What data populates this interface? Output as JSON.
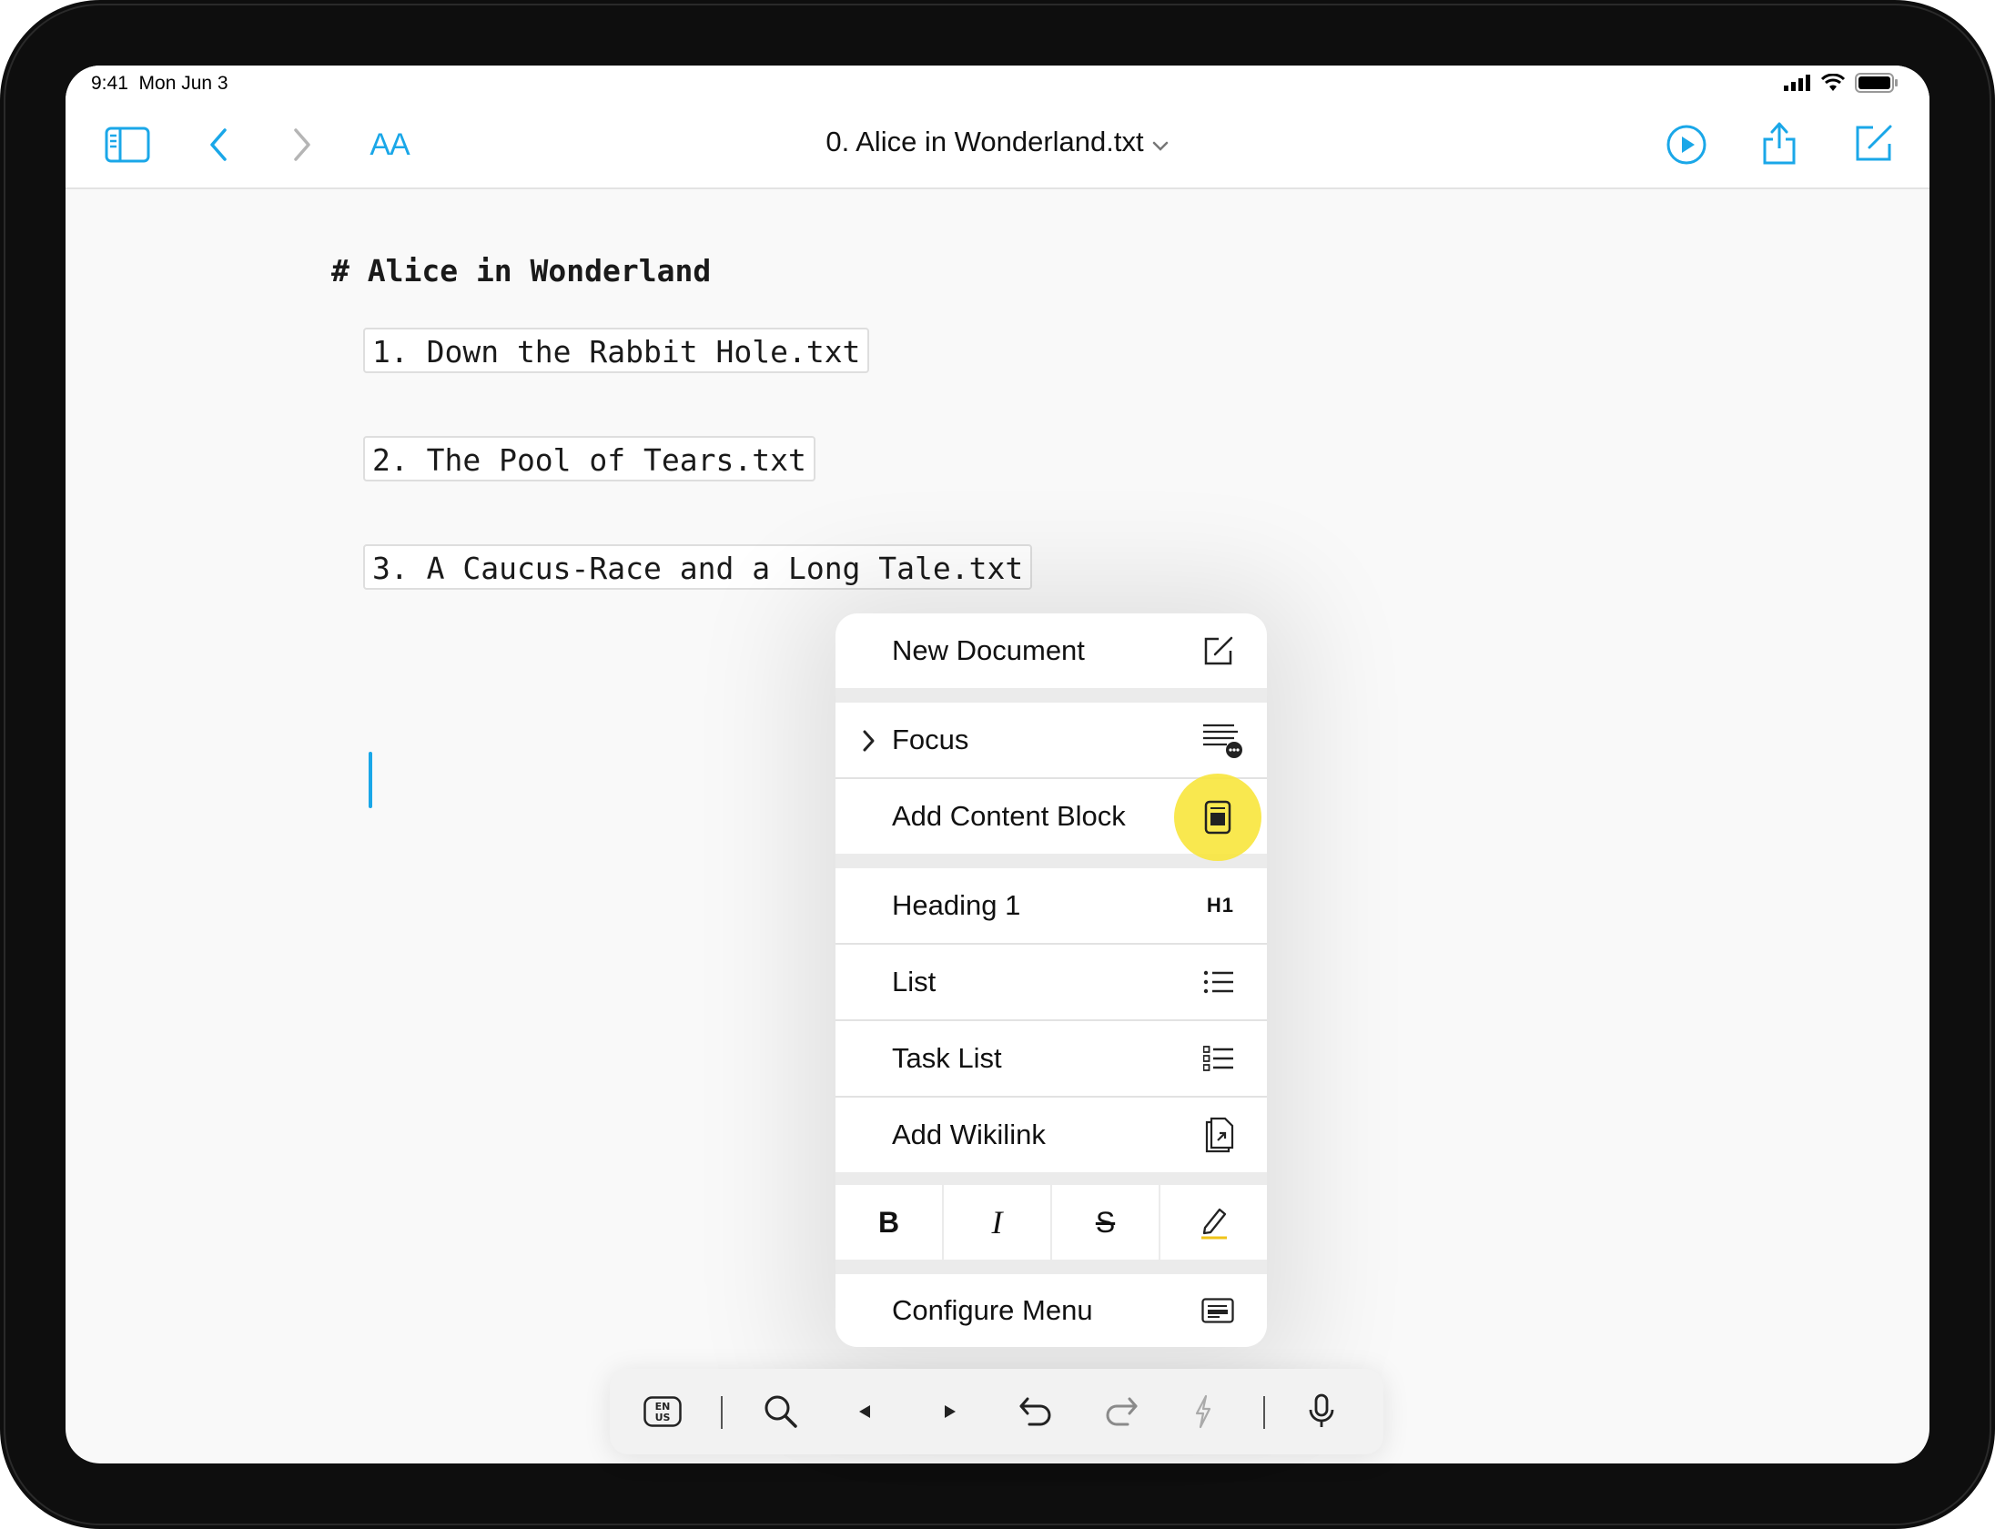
{
  "status": {
    "time": "9:41",
    "date": "Mon Jun 3"
  },
  "toolbar": {
    "title": "0. Alice in Wonderland.txt",
    "font_size_label": "AA"
  },
  "document": {
    "heading": "# Alice in Wonderland",
    "blocks": [
      "1. Down the Rabbit Hole.txt",
      "2. The Pool of Tears.txt",
      "3. A Caucus-Race and a Long Tale.txt"
    ]
  },
  "menu": {
    "items": [
      {
        "label": "New Document",
        "icon": "compose-icon"
      },
      {
        "label": "Focus",
        "icon": "focus-icon"
      },
      {
        "label": "Add Content Block",
        "icon": "content-block-icon"
      },
      {
        "label": "Heading 1",
        "icon": "H1"
      },
      {
        "label": "List",
        "icon": "list-icon"
      },
      {
        "label": "Task List",
        "icon": "task-list-icon"
      },
      {
        "label": "Add Wikilink",
        "icon": "wikilink-icon"
      },
      {
        "label": "Configure Menu",
        "icon": "configure-icon"
      }
    ],
    "format": {
      "bold": "B",
      "italic": "I",
      "strike": "S"
    }
  },
  "keyboard_bar": {
    "language": "EN US"
  },
  "colors": {
    "accent": "#1aa7e8",
    "highlight": "#f8e63c"
  }
}
